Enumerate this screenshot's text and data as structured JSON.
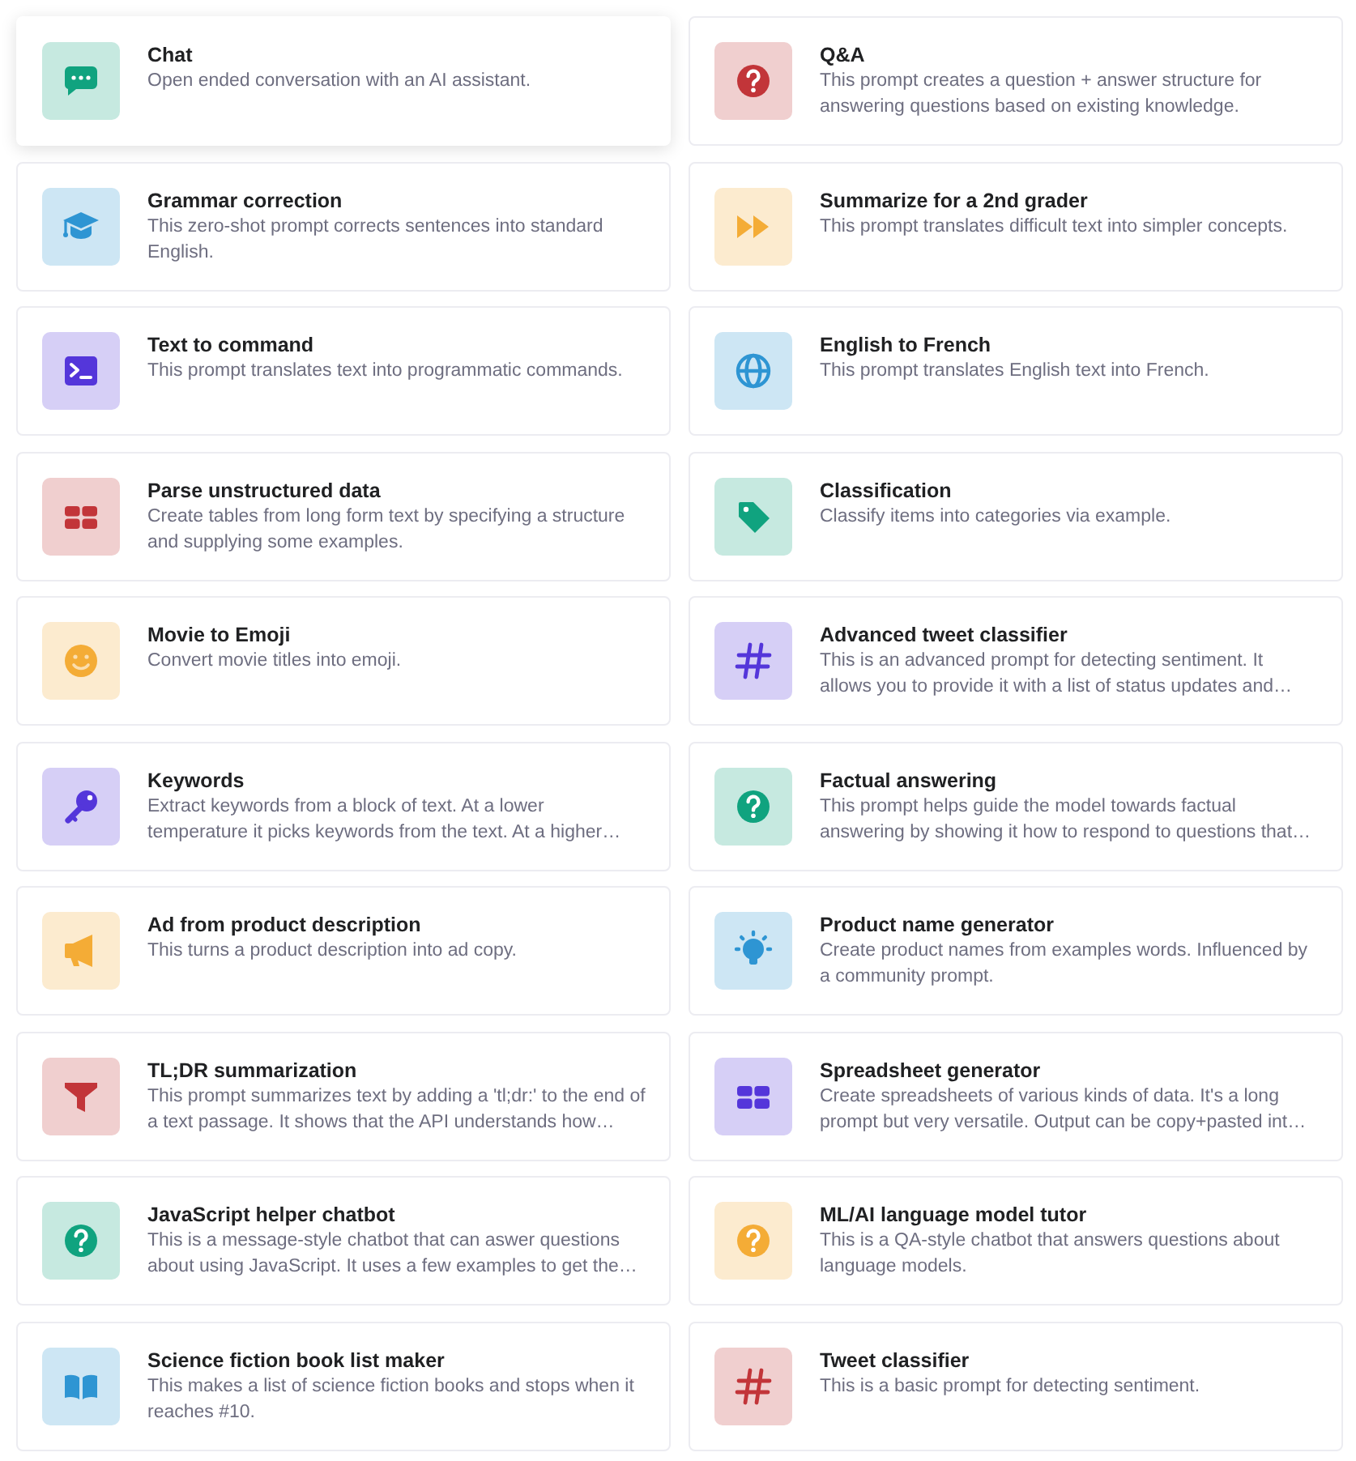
{
  "prompts": [
    {
      "title": "Chat",
      "description": "Open ended conversation with an AI assistant.",
      "kind": "chat",
      "color": "#10a37f",
      "hovered": true
    },
    {
      "title": "Q&A",
      "description": "This prompt creates a question + answer structure for answering questions based on existing knowledge.",
      "kind": "question",
      "color": "#c23539",
      "hovered": false
    },
    {
      "title": "Grammar correction",
      "description": "This zero-shot prompt corrects sentences into standard English.",
      "kind": "cap",
      "color": "#2e95d3",
      "hovered": false
    },
    {
      "title": "Summarize for a 2nd grader",
      "description": "This prompt translates difficult text into simpler concepts.",
      "kind": "fastforward",
      "color": "#f4ac36",
      "hovered": false
    },
    {
      "title": "Text to command",
      "description": "This prompt translates text into programmatic commands.",
      "kind": "terminal",
      "color": "#5436da",
      "hovered": false
    },
    {
      "title": "English to French",
      "description": "This prompt translates English text into French.",
      "kind": "globe",
      "color": "#2e95d3",
      "hovered": false
    },
    {
      "title": "Parse unstructured data",
      "description": "Create tables from long form text by specifying a structure and supplying some examples.",
      "kind": "table",
      "color": "#c23539",
      "hovered": false
    },
    {
      "title": "Classification",
      "description": "Classify items into categories via example.",
      "kind": "tag",
      "color": "#10a37f",
      "hovered": false
    },
    {
      "title": "Movie to Emoji",
      "description": "Convert movie titles into emoji.",
      "kind": "smiley",
      "color": "#f4ac36",
      "hovered": false
    },
    {
      "title": "Advanced tweet classifier",
      "description": "This is an advanced prompt for detecting sentiment. It allows you to provide it with a list of status updates and…",
      "kind": "hash",
      "color": "#5436da",
      "hovered": false
    },
    {
      "title": "Keywords",
      "description": "Extract keywords from a block of text. At a lower temperature it picks keywords from the text. At a higher…",
      "kind": "key",
      "color": "#5436da",
      "hovered": false
    },
    {
      "title": "Factual answering",
      "description": "This prompt helps guide the model towards factual answering by showing it how to respond to questions that…",
      "kind": "question",
      "color": "#10a37f",
      "hovered": false
    },
    {
      "title": "Ad from product description",
      "description": "This turns a product description into ad copy.",
      "kind": "megaphone",
      "color": "#f4ac36",
      "hovered": false
    },
    {
      "title": "Product name generator",
      "description": "Create product names from examples words. Influenced by a community prompt.",
      "kind": "bulb",
      "color": "#2e95d3",
      "hovered": false
    },
    {
      "title": "TL;DR summarization",
      "description": "This prompt summarizes text by adding a 'tl;dr:' to the end of a text passage. It shows that the API understands how…",
      "kind": "funnel",
      "color": "#c23539",
      "hovered": false
    },
    {
      "title": "Spreadsheet generator",
      "description": "Create spreadsheets of various kinds of data. It's a long prompt but very versatile. Output can be copy+pasted int…",
      "kind": "table",
      "color": "#5436da",
      "hovered": false
    },
    {
      "title": "JavaScript helper chatbot",
      "description": "This is a message-style chatbot that can aswer questions about using JavaScript. It uses a few examples to get the…",
      "kind": "question",
      "color": "#10a37f",
      "hovered": false
    },
    {
      "title": "ML/AI language model tutor",
      "description": "This is a QA-style chatbot that answers questions about language models.",
      "kind": "question",
      "color": "#f4ac36",
      "hovered": false
    },
    {
      "title": "Science fiction book list maker",
      "description": "This makes a list of science fiction books and stops when it reaches #10.",
      "kind": "book",
      "color": "#2e95d3",
      "hovered": false
    },
    {
      "title": "Tweet classifier",
      "description": "This is a basic prompt for detecting sentiment.",
      "kind": "hash",
      "color": "#c23539",
      "hovered": false
    }
  ]
}
